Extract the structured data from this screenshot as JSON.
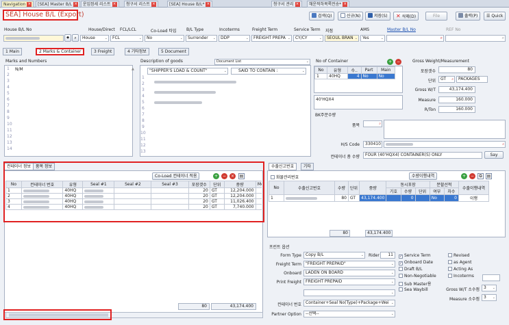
{
  "window_tabs": [
    {
      "label": "Navigation",
      "active": true
    },
    {
      "label": "[SEA] Master B/L",
      "active": false
    },
    {
      "label": "운임정세 리스트",
      "active": false
    },
    {
      "label": "청구서 리스트",
      "active": false
    },
    {
      "label": "[SEA] House B/L*",
      "active": false
    },
    {
      "label": "청구서 관리",
      "active": false
    },
    {
      "label": "해운적하목록전송*",
      "active": false
    }
  ],
  "page_title": "SEA] House B/L (Export)",
  "toolbar": {
    "search": "검색(Q)",
    "new": "신규(N)",
    "save": "저장(S)",
    "delete": "삭제(D)",
    "file": "File",
    "print": "출력(P)",
    "quick": "Quick"
  },
  "header_labels": {
    "house_bl_no": "House B/L No",
    "house_direct": "House/Direct",
    "fcl_lcl": "FCL/LCL",
    "coload": "Co-Load 타입",
    "bl_type": "B/L Type",
    "incoterms": "Incoterms",
    "freight_term": "Freight Term",
    "service_term": "Service Term",
    "branch": "지점",
    "ams": "AMS",
    "master_bl_no": "Master B/L No",
    "ref_no": "REF No"
  },
  "header_values": {
    "house_direct": "House",
    "fcl_lcl": "FCL",
    "coload": "No",
    "bl_type": "Surrender",
    "incoterms": "DDP",
    "freight_term": "FREIGHT PREPA",
    "service_term": "CY/CY",
    "branch": "SEOUL BRAN",
    "ams": "Yes"
  },
  "sub_tabs": [
    "1 Main",
    "2 Marks & Container",
    "3 Freight",
    "4 기타정보",
    "5 Document"
  ],
  "marks": {
    "label": "Marks and Numbers",
    "line1": "N/M",
    "line_numbers": [
      "1",
      "2",
      "3",
      "4",
      "5",
      "6",
      "7",
      "8",
      "9",
      "10",
      "11",
      "12",
      "13",
      "14"
    ]
  },
  "description": {
    "label": "Description of goods",
    "doc_list": "Document List",
    "said1": "\"SHIPPER'S LOAD & COUNT\"",
    "said2": "SAID TO CONTAIN :",
    "line_numbers": [
      "1",
      "2",
      "3",
      "4",
      "5",
      "6",
      "7",
      "8",
      "9",
      "10",
      "11",
      "12",
      "13"
    ]
  },
  "no_of_container": {
    "label": "No of Container",
    "columns": [
      "No",
      "유형",
      "수..",
      "Part",
      "Main"
    ],
    "rows": [
      [
        "1",
        "40HQ",
        "4",
        "No",
        "No"
      ]
    ],
    "summary": "40'HQX4",
    "bk_label": "BK주문수량",
    "item_label": "품목",
    "hs_code_label": "H/S Code",
    "hs_code": "330410",
    "container_qty_label": "컨테이너 총 수량",
    "container_qty": "FOUR (40'HQX4) CONTAINER(S) ONLY",
    "say_button": "Say"
  },
  "gross": {
    "label": "Gross Weight/Measurement",
    "pkg_label": "포장갯수",
    "pkg_value": "80",
    "unit_label": "단위",
    "unit_code": "GT",
    "unit_name": "PACKAGES",
    "gw_label": "Gross W/T",
    "gw_value": "43,174.400",
    "measure_label": "Measure",
    "measure_value": "160.000",
    "rton_label": "R/Ton",
    "rton_value": "160.000"
  },
  "container_info": {
    "tabs": [
      "컨테이너 정보",
      "품목 정보"
    ],
    "coload_button": "Co-Load 컨테이너 적용",
    "columns": [
      "No",
      "컨테이너 번호",
      "유형",
      "Seal #1",
      "Seal #2",
      "Seal #3",
      "포장갯수",
      "단위",
      "중량",
      "Me"
    ],
    "rows": [
      [
        "1",
        "40HQ",
        "20",
        "GT",
        "12,204.000"
      ],
      [
        "2",
        "40HQ",
        "20",
        "GT",
        "12,204.000"
      ],
      [
        "3",
        "40HQ",
        "20",
        "GT",
        "11,026.400"
      ],
      [
        "4",
        "40HQ",
        "20",
        "GT",
        "7,740.000"
      ]
    ],
    "total_pkg": "80",
    "total_weight": "43,174.400"
  },
  "export_decl": {
    "tabs": [
      "수출신고번호",
      "기타"
    ],
    "checkbox_label": "화물관리번호",
    "match_button": "수량이행내역",
    "columns": [
      "No",
      "수출신고번호",
      "수량",
      "단위",
      "중량",
      "동시포장",
      "분할선적",
      "수출이행내역"
    ],
    "sub_columns": [
      "기호",
      "수량",
      "단위",
      "여부",
      "차수"
    ],
    "rows": [
      [
        "1",
        "80",
        "GT",
        "43,174.400",
        "0",
        "No",
        "0",
        "이행"
      ]
    ],
    "total_qty": "80",
    "total_weight": "43,174.400"
  },
  "print_options": {
    "title": "프린트 옵션",
    "form_type_label": "Form Type",
    "form_type": "Copy B/L",
    "rider_label": "Rider",
    "rider_value": "11",
    "freight_term_label": "Freight Term",
    "freight_term": "\"FREIGHT PREPAID\"",
    "onboard_label": "Onboard",
    "onboard": "LADEN ON BOARD",
    "print_freight_label": "Print Freight",
    "print_freight": "FREIGHT PREPAID",
    "container_no_label": "컨테이너 번호",
    "container_no": "Container+Seal No(Type)+Package+Wei",
    "partner_option_label": "Partner Option",
    "partner_option": "--선택--",
    "checks_left": [
      {
        "label": "Service Term",
        "checked": true
      },
      {
        "label": "Onboard Date",
        "checked": true
      },
      {
        "label": "Draft B/L",
        "checked": false
      },
      {
        "label": "Non-Negotiable",
        "checked": false
      },
      {
        "label": "Sub Master용",
        "checked": false
      },
      {
        "label": "Sea Waybill",
        "checked": false
      }
    ],
    "checks_right": [
      {
        "label": "Revised",
        "checked": false
      },
      {
        "label": "as Agent",
        "checked": false
      },
      {
        "label": "Acting As",
        "checked": false
      },
      {
        "label": "Incoterms",
        "checked": false
      }
    ],
    "gw_decimal_label": "Gross W/T 소수점",
    "gw_decimal": "3",
    "measure_decimal_label": "Measure 소수점",
    "measure_decimal": "3"
  }
}
